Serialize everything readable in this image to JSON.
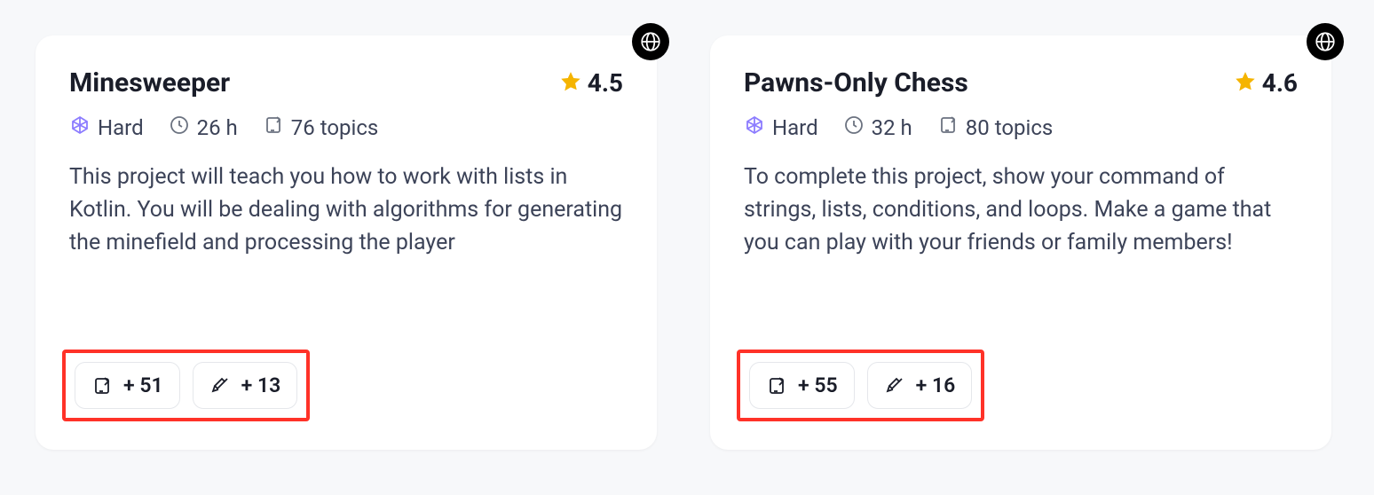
{
  "cards": [
    {
      "title": "Minesweeper",
      "rating": "4.5",
      "difficulty": "Hard",
      "duration": "26 h",
      "topics": "76 topics",
      "description": "This project will teach you how to work with lists in Kotlin. You will be dealing with algorithms for generating the minefield and processing the player",
      "desc_fade": true,
      "pill_topics": "+ 51",
      "pill_projects": "+ 13"
    },
    {
      "title": "Pawns-Only Chess",
      "rating": "4.6",
      "difficulty": "Hard",
      "duration": "32 h",
      "topics": "80 topics",
      "description": "To complete this project, show your command of strings, lists, conditions, and loops. Make a game that you can play with your friends or family members!",
      "desc_fade": false,
      "pill_topics": "+ 55",
      "pill_projects": "+ 16"
    }
  ]
}
